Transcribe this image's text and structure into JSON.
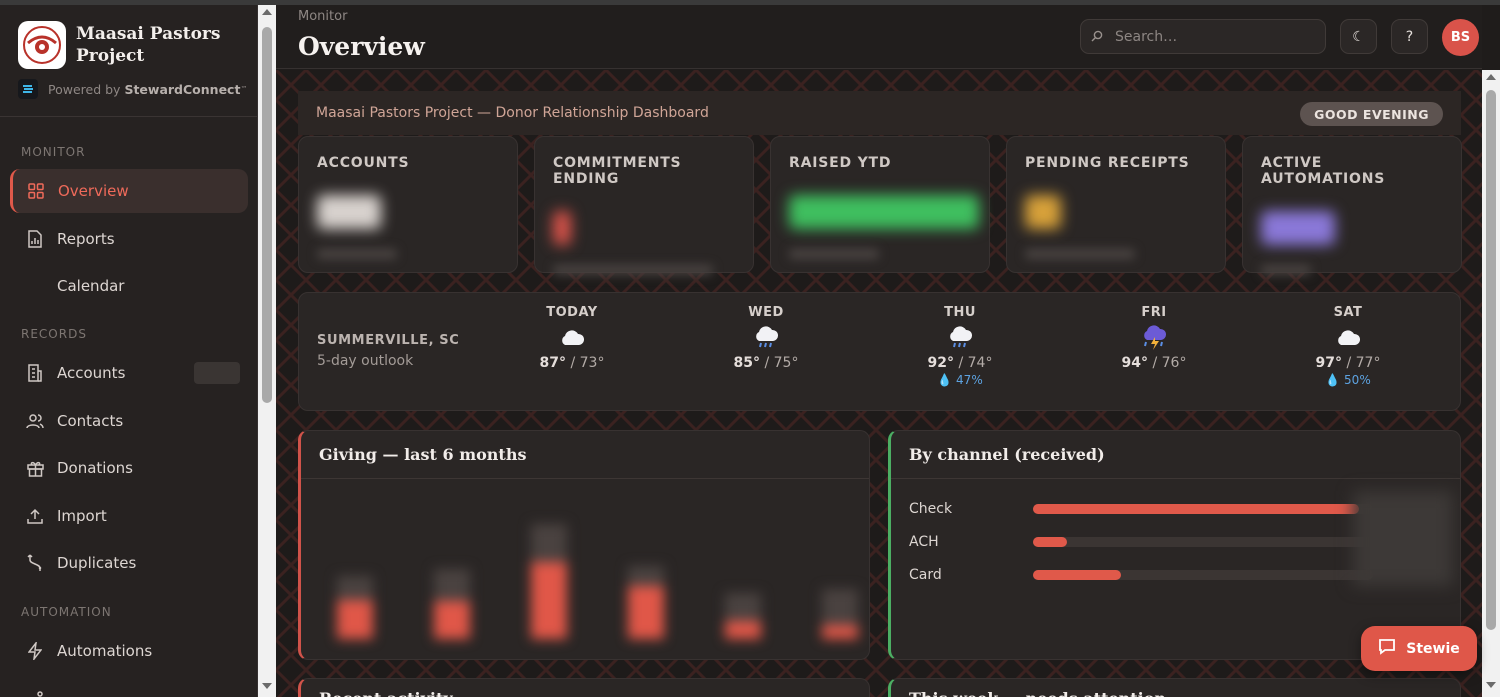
{
  "app": {
    "name": "Maasai Pastors Project",
    "powered_prefix": "Powered by",
    "powered_brand": "StewardConnect",
    "powered_tm": "™"
  },
  "sidebar": {
    "sections": {
      "monitor": "MONITOR",
      "records": "RECORDS",
      "automation": "AUTOMATION"
    },
    "items": {
      "overview": "Overview",
      "reports": "Reports",
      "calendar": "Calendar",
      "accounts": "Accounts",
      "contacts": "Contacts",
      "donations": "Donations",
      "import": "Import",
      "duplicates": "Duplicates",
      "automations": "Automations"
    }
  },
  "header": {
    "breadcrumb": "Monitor",
    "title": "Overview",
    "search_placeholder": "Search…",
    "avatar_initials": "BS",
    "theme_icon": "☾",
    "help_icon": "?"
  },
  "banner": {
    "text": "Maasai Pastors Project — Donor Relationship Dashboard",
    "greeting": "GOOD EVENING"
  },
  "kpis": {
    "accounts": {
      "label": "ACCOUNTS",
      "color": "#d8d2ce"
    },
    "commitments": {
      "label": "COMMITMENTS ENDING",
      "color": "#d9534a"
    },
    "raised": {
      "label": "RAISED YTD",
      "color": "#3fbf5f"
    },
    "pending": {
      "label": "PENDING RECEIPTS",
      "color": "#d7a13a"
    },
    "automations": {
      "label": "ACTIVE AUTOMATIONS",
      "color": "#8a78d8"
    }
  },
  "weather": {
    "location": "SUMMERVILLE, SC",
    "subtitle": "5-day outlook",
    "days": [
      {
        "name": "TODAY",
        "icon": "cloud-icon",
        "high": "87°",
        "low": "73°",
        "precip": ""
      },
      {
        "name": "WED",
        "icon": "rain-cloud-icon",
        "high": "85°",
        "low": "75°",
        "precip": ""
      },
      {
        "name": "THU",
        "icon": "rain-cloud-icon",
        "high": "92°",
        "low": "74°",
        "precip": "47%"
      },
      {
        "name": "FRI",
        "icon": "storm-cloud-icon",
        "high": "94°",
        "low": "76°",
        "precip": ""
      },
      {
        "name": "SAT",
        "icon": "cloud-icon",
        "high": "97°",
        "low": "77°",
        "precip": "50%"
      }
    ]
  },
  "panels": {
    "giving_title": "Giving — last 6 months",
    "channel_title": "By channel (received)",
    "recent_title": "Recent activity",
    "attention_title": "This week — needs attention"
  },
  "channels": [
    {
      "name": "Check",
      "share": 0.96
    },
    {
      "name": "ACH",
      "share": 0.1
    },
    {
      "name": "Card",
      "share": 0.26
    }
  ],
  "giving_bars": [
    {
      "total": 0.45,
      "received": 0.28
    },
    {
      "total": 0.5,
      "received": 0.27
    },
    {
      "total": 0.82,
      "received": 0.55
    },
    {
      "total": 0.52,
      "received": 0.38
    },
    {
      "total": 0.33,
      "received": 0.13
    },
    {
      "total": 0.36,
      "received": 0.1
    }
  ],
  "chat": {
    "label": "Stewie"
  }
}
